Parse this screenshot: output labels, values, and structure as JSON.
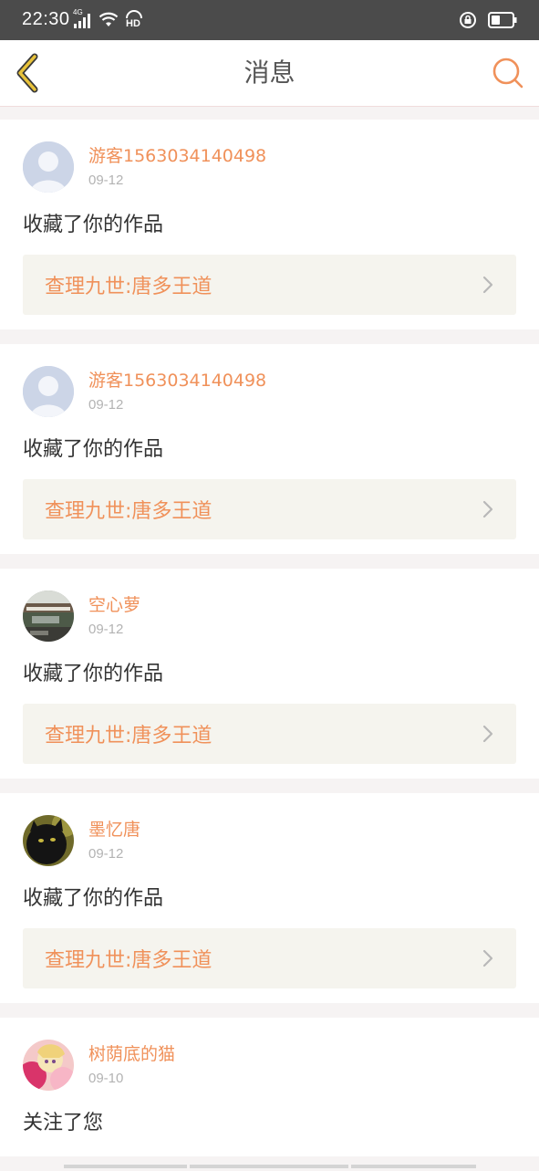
{
  "status_bar": {
    "time": "22:30",
    "network": "4G",
    "hd": "HD"
  },
  "header": {
    "title": "消息"
  },
  "messages": [
    {
      "user": "游客1563034140498",
      "date": "09-12",
      "action": "收藏了你的作品",
      "work_title": "查理九世:唐多王道",
      "avatar": "default-avatar"
    },
    {
      "user": "游客1563034140498",
      "date": "09-12",
      "action": "收藏了你的作品",
      "work_title": "查理九世:唐多王道",
      "avatar": "default-avatar"
    },
    {
      "user": "空心萝",
      "date": "09-12",
      "action": "收藏了你的作品",
      "work_title": "查理九世:唐多王道",
      "avatar": "photo-avatar-building"
    },
    {
      "user": "墨忆唐",
      "date": "09-12",
      "action": "收藏了你的作品",
      "work_title": "查理九世:唐多王道",
      "avatar": "photo-avatar-cat"
    },
    {
      "user": "树荫底的猫",
      "date": "09-10",
      "action": "关注了您",
      "avatar": "photo-avatar-anime"
    }
  ],
  "colors": {
    "accent": "#f0915a",
    "back_arrow": "#e8a83a",
    "status_bar": "#4b4b4b",
    "page_bg": "#f6f3f3",
    "work_bg": "#f5f4ee"
  }
}
